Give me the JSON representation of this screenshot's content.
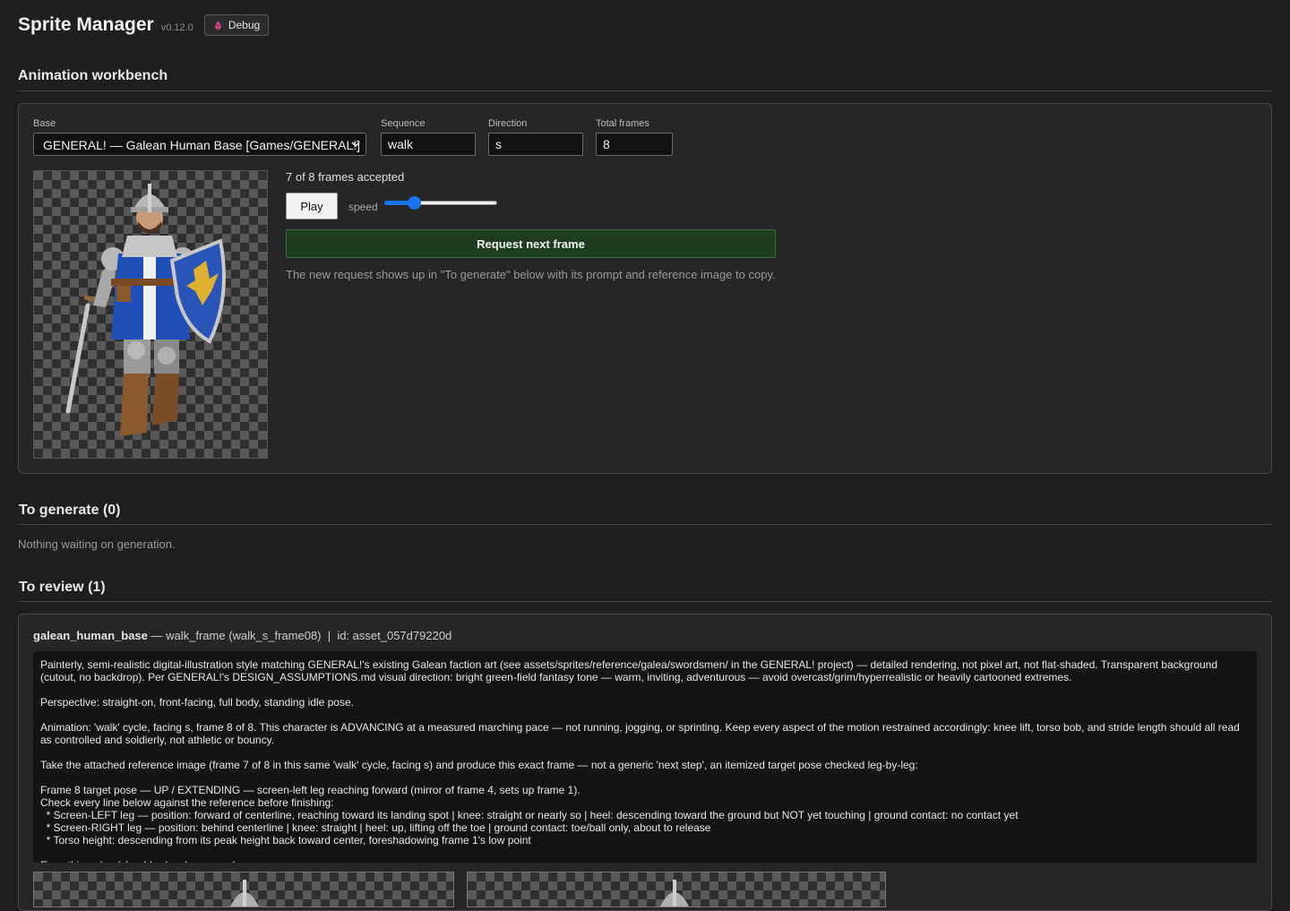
{
  "app": {
    "title": "Sprite Manager",
    "version": "v0.12.0",
    "debug_label": "Debug"
  },
  "workbench": {
    "heading": "Animation workbench",
    "base_label": "Base",
    "base_value": "GENERAL! — Galean Human Base [Games/GENERAL!]",
    "sequence_label": "Sequence",
    "sequence_value": "walk",
    "direction_label": "Direction",
    "direction_value": "s",
    "total_frames_label": "Total frames",
    "total_frames_value": "8",
    "frames_status": "7 of 8 frames accepted",
    "play_label": "Play",
    "speed_label": "speed",
    "speed_level": 0.26,
    "request_label": "Request next frame",
    "hint": "The new request shows up in \"To generate\" below with its prompt and reference image to copy."
  },
  "to_generate": {
    "heading": "To generate (0)",
    "empty_text": "Nothing waiting on generation."
  },
  "to_review": {
    "heading": "To review (1)",
    "item": {
      "asset_name": "galean_human_base",
      "detail": " — walk_frame (walk_s_frame08)  |  id: asset_057d79220d",
      "prompt_paragraphs": [
        "Painterly, semi-realistic digital-illustration style matching GENERAL!'s existing Galean faction art (see assets/sprites/reference/galea/swordsmen/ in the GENERAL! project) — detailed rendering, not pixel art, not flat-shaded. Transparent background (cutout, no backdrop). Per GENERAL!'s DESIGN_ASSUMPTIONS.md visual direction: bright green-field fantasy tone — warm, inviting, adventurous — avoid overcast/grim/hyperrealistic or heavily cartooned extremes.",
        "Perspective: straight-on, front-facing, full body, standing idle pose.",
        "Animation: 'walk' cycle, facing s, frame 8 of 8. This character is ADVANCING at a measured marching pace — not running, jogging, or sprinting. Keep every aspect of the motion restrained accordingly: knee lift, torso bob, and stride length should all read as controlled and soldierly, not athletic or bouncy.",
        "Take the attached reference image (frame 7 of 8 in this same 'walk' cycle, facing s) and produce this exact frame — not a generic 'next step', an itemized target pose checked leg-by-leg:",
        "Frame 8 target pose — UP / EXTENDING — screen-left leg reaching forward (mirror of frame 4, sets up frame 1).\nCheck every line below against the reference before finishing:\n  * Screen-LEFT leg — position: forward of centerline, reaching toward its landing spot | knee: straight or nearly so | heel: descending toward the ground but NOT yet touching | ground contact: no contact yet\n  * Screen-RIGHT leg — position: behind centerline | knee: straight | heel: up, lifting off the toe | ground contact: toe/ball only, about to release\n  * Torso height: descending from its peak height back toward center, foreshadowing frame 1's low point",
        "Everything else (shoulder-level armor, ...) ..."
      ]
    }
  },
  "colors": {
    "accent": "#1a73e8",
    "request_button": "#1e3d1e",
    "tabard": "#1f4fb8",
    "crest": "#e0b030"
  },
  "icons": {
    "debug": "bug-icon",
    "select": "chevron-down-icon"
  }
}
